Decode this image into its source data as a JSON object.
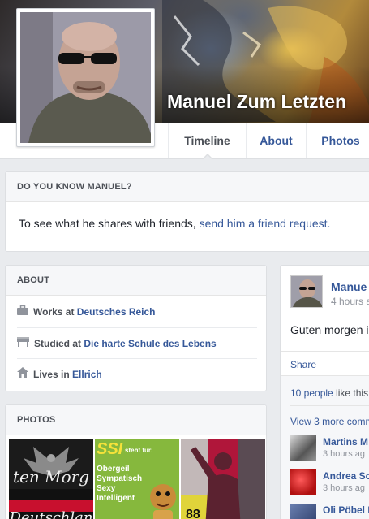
{
  "profile": {
    "name": "Manuel Zum Letzten"
  },
  "nav": {
    "tabs": [
      {
        "label": "Timeline",
        "active": true
      },
      {
        "label": "About",
        "active": false
      },
      {
        "label": "Photos",
        "active": false
      }
    ]
  },
  "know_card": {
    "header": "DO YOU KNOW MANUEL?",
    "text_prefix": "To see what he shares with friends, ",
    "link_text": "send him a friend request."
  },
  "about_card": {
    "header": "ABOUT",
    "items": [
      {
        "icon": "briefcase-icon",
        "label": "Works at ",
        "value": "Deutsches Reich"
      },
      {
        "icon": "school-icon",
        "label": "Studied at ",
        "value": "Die harte Schule des Lebens"
      },
      {
        "icon": "home-icon",
        "label": "Lives in ",
        "value": "Ellrich"
      }
    ]
  },
  "photos_card": {
    "header": "PHOTOS",
    "tiles": [
      {
        "name": "photo-eagle",
        "caption_top": "ten Morg",
        "caption_bottom": "Deutschlan"
      },
      {
        "name": "photo-ssi-meme",
        "caption_big": "SSI",
        "caption_small": "steht für:",
        "lines": [
          "Obergeil",
          "Sympatisch",
          "Sexy",
          "Intelligent"
        ]
      },
      {
        "name": "photo-silhouette",
        "caption": "88"
      }
    ]
  },
  "post": {
    "author": "Manue",
    "time": "4 hours a",
    "body": "Guten morgen i",
    "share_label": "Share",
    "likes_link": "10 people",
    "likes_rest": " like this",
    "view_more": "View 3 more comm",
    "comments": [
      {
        "name": "Martins M",
        "time": "3 hours ag"
      },
      {
        "name": "Andrea Sc",
        "time": "3 hours ag"
      },
      {
        "name": "Oli Pöbel M",
        "time": ""
      }
    ]
  },
  "colors": {
    "link": "#365899",
    "background": "#e9ebee",
    "card": "#ffffff",
    "muted": "#90949c"
  }
}
